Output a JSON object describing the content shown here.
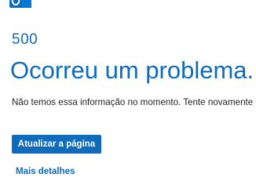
{
  "app": {
    "logo_icon": "outlook-logo-icon",
    "accent_color": "#0f6cbd"
  },
  "error": {
    "code": "500",
    "title": "Ocorreu um problema.",
    "message": "Não temos essa informação no momento. Tente novamente mais tarde."
  },
  "actions": {
    "reload_label": "Atualizar a página",
    "details_label": "Mais detalhes"
  }
}
